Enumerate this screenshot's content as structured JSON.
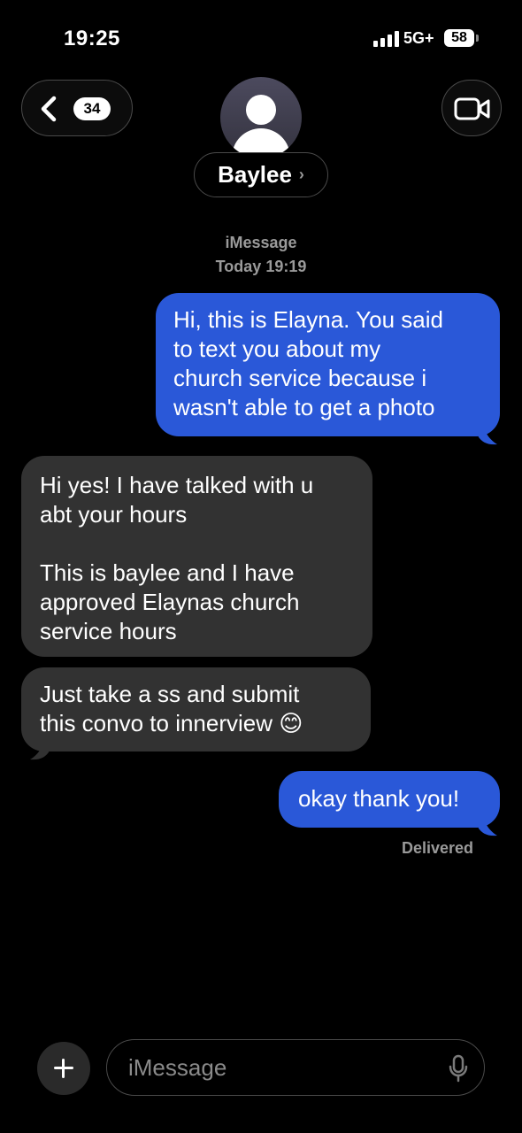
{
  "status_bar": {
    "time": "19:25",
    "network": "5G+",
    "battery": "58"
  },
  "header": {
    "back_count": "34",
    "contact_name": "Baylee",
    "chevron": "›"
  },
  "meta": {
    "service": "iMessage",
    "timestamp": "Today 19:19"
  },
  "messages": [
    {
      "from": "me",
      "text": "Hi, this is Elayna. You said\nto text you about my\nchurch service because i\nwasn't able to get a photo"
    },
    {
      "from": "them",
      "text": "Hi yes! I have talked with u\nabt your hours\n\nThis is baylee and I have\napproved Elaynas church\nservice hours"
    },
    {
      "from": "them",
      "text": "Just take a ss and submit\nthis convo to innerview 😊"
    },
    {
      "from": "me",
      "text": "okay thank you!"
    }
  ],
  "delivery_status": "Delivered",
  "composer": {
    "placeholder": "iMessage"
  },
  "colors": {
    "sent_bubble": "#2a58d8",
    "received_bubble": "#323232",
    "background": "#000000"
  }
}
